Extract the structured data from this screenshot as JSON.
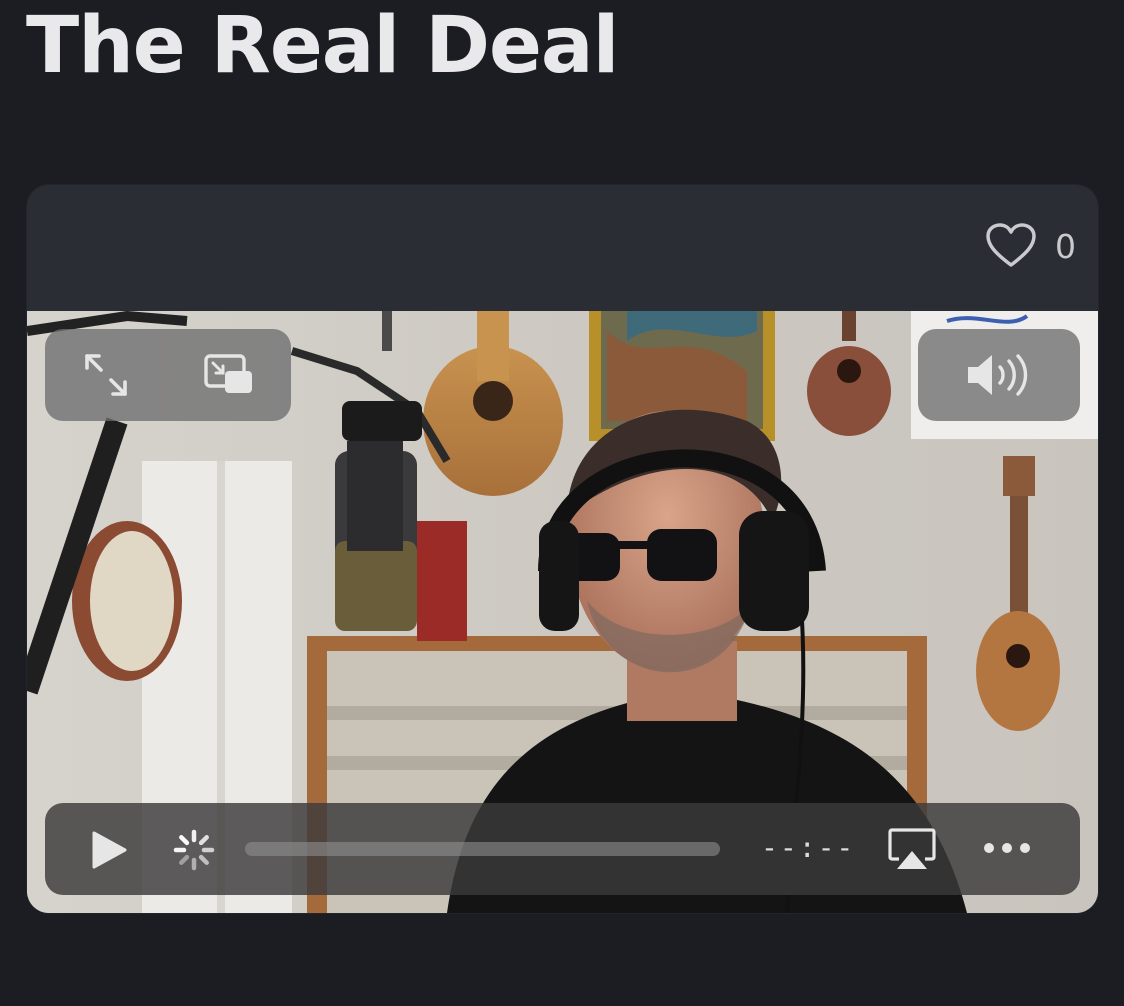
{
  "page": {
    "title": "The Real Deal"
  },
  "card": {
    "likes": {
      "icon": "heart-icon",
      "count": "0"
    }
  },
  "player": {
    "top_left_controls": [
      {
        "icon": "expand-fullscreen-icon"
      },
      {
        "icon": "picture-in-picture-icon"
      }
    ],
    "top_right_controls": [
      {
        "icon": "volume-icon"
      }
    ],
    "bottom_controls": {
      "play_icon": "play-icon",
      "loading_icon": "loading-spinner-icon",
      "time_display": "--:--",
      "airplay_icon": "airplay-icon",
      "more_icon": "more-options-icon"
    }
  },
  "colors": {
    "background": "#1c1d22",
    "card": "#2a2d33",
    "title_text": "#e9e9ec",
    "control_pill": "#6e6e70"
  }
}
